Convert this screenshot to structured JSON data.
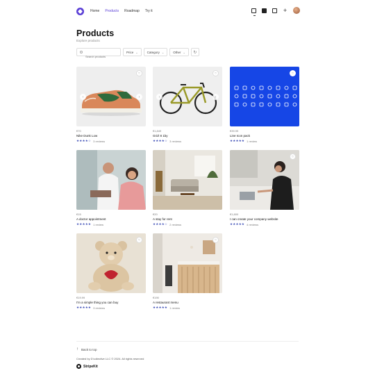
{
  "header": {
    "nav": [
      "Home",
      "Products",
      "Roadmap",
      "Try it"
    ],
    "active": "Products"
  },
  "page": {
    "title": "Products",
    "subtitle": "Explore products"
  },
  "filters": {
    "search_placeholder": "Search products",
    "price": "Price",
    "category": "Category",
    "other": "Other"
  },
  "products": [
    {
      "price": "€70",
      "name": "Nike Dunk Low",
      "stars": "★★★★☆",
      "reviews": "3 reviews"
    },
    {
      "price": "€1,849",
      "name": "Grizl 8 1by",
      "stars": "★★★★☆",
      "reviews": "3 reviews"
    },
    {
      "price": "€39.99",
      "name": "Line Icon pack",
      "stars": "★★★★★",
      "reviews": "1 review"
    },
    {
      "price": "€15",
      "name": "A doctor appointment",
      "stars": "★★★★★",
      "reviews": "1 review"
    },
    {
      "price": "€20",
      "name": "A stay for rent",
      "stars": "★★★★☆",
      "reviews": "2 reviews"
    },
    {
      "price": "€1,800",
      "name": "I can create your company website",
      "stars": "★★★★★",
      "reviews": "4 reviews"
    },
    {
      "price": "€19.99",
      "name": "I'm a simple thing you can buy",
      "stars": "★★★★★",
      "reviews": "3 reviews"
    },
    {
      "price": "€190",
      "name": "A restaurant menu",
      "stars": "★★★★★",
      "reviews": "1 review"
    }
  ],
  "footer": {
    "back_to_top": "Back to top",
    "copyright": "Created by D'collective LLC © 2024. All rights reserved",
    "brand": "StripeKit"
  },
  "colors": {
    "accent": "#5b3fd6",
    "stars": "#3a4bb5",
    "icon_pack_bg": "#1646e6"
  }
}
